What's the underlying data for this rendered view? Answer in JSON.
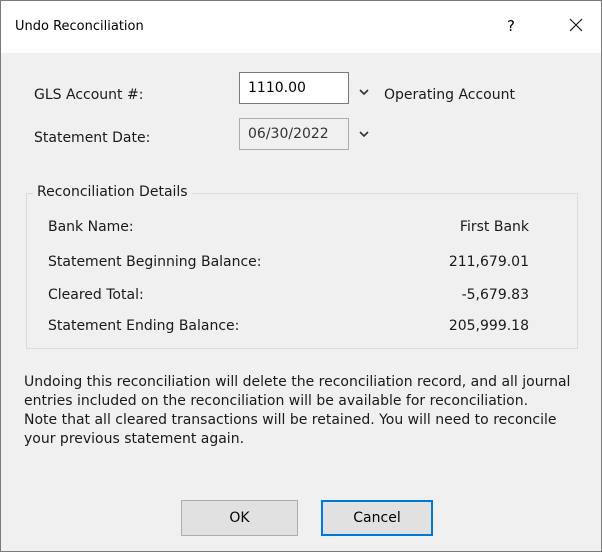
{
  "dialog": {
    "title": "Undo Reconciliation",
    "help_label": "?"
  },
  "form": {
    "account_label": "GLS Account #:",
    "account_value": "1110.00",
    "account_name": "Operating Account",
    "date_label": "Statement Date:",
    "date_value": "06/30/2022"
  },
  "details": {
    "legend": "Reconciliation Details",
    "rows": [
      {
        "label": "Bank Name:",
        "value": "First Bank"
      },
      {
        "label": "Statement Beginning Balance:",
        "value": "211,679.01"
      },
      {
        "label": "Cleared Total:",
        "value": "-5,679.83"
      },
      {
        "label": "Statement Ending Balance:",
        "value": "205,999.18"
      }
    ]
  },
  "note": {
    "line1": "Undoing this reconciliation will delete the reconciliation record, and all journal entries included on the reconciliation will be available for reconciliation.",
    "line2": "Note that all cleared transactions will be retained.  You will need to reconcile your previous statement again."
  },
  "buttons": {
    "ok": "OK",
    "cancel": "Cancel"
  }
}
